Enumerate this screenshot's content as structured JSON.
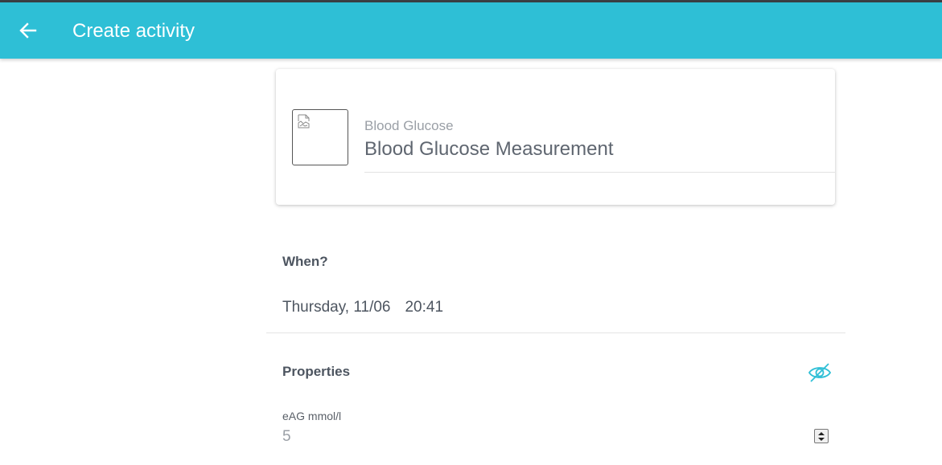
{
  "appbar": {
    "title": "Create activity",
    "back_icon": "arrow-left-icon",
    "color": "#2ebfd6"
  },
  "activity_card": {
    "category": "Blood Glucose",
    "name": "Blood Glucose Measurement",
    "thumbnail_icon": "broken-image-icon"
  },
  "when": {
    "label": "When?",
    "date": "Thursday, 11/06",
    "time": "20:41"
  },
  "properties": {
    "label": "Properties",
    "visibility_icon": "eye-off-icon",
    "accent_color": "#2ebfd6",
    "fields": [
      {
        "label": "eAG mmol/l",
        "value": "5"
      }
    ]
  }
}
